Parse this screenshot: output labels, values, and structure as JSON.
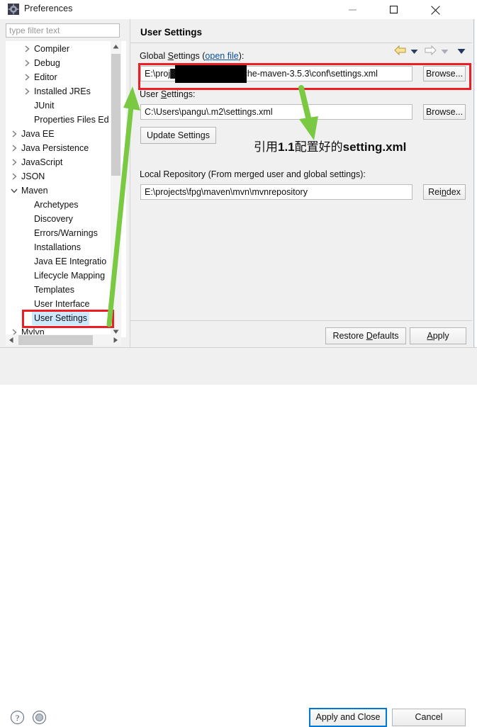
{
  "window": {
    "title": "Preferences",
    "icon": "preferences-gear-icon",
    "controls": {
      "minimize": "minimize-icon",
      "maximize": "maximize-icon",
      "close": "close-icon"
    }
  },
  "filter": {
    "placeholder": "type filter text",
    "value": ""
  },
  "tree": {
    "items": [
      {
        "label": "Compiler",
        "indent": 2,
        "twisty": "collapsed",
        "selected": false
      },
      {
        "label": "Debug",
        "indent": 2,
        "twisty": "collapsed",
        "selected": false
      },
      {
        "label": "Editor",
        "indent": 2,
        "twisty": "collapsed",
        "selected": false
      },
      {
        "label": "Installed JREs",
        "indent": 2,
        "twisty": "collapsed",
        "selected": false
      },
      {
        "label": "JUnit",
        "indent": 2,
        "twisty": "none",
        "selected": false
      },
      {
        "label": "Properties Files Ed",
        "indent": 2,
        "twisty": "none",
        "selected": false
      },
      {
        "label": "Java EE",
        "indent": 1,
        "twisty": "collapsed",
        "selected": false
      },
      {
        "label": "Java Persistence",
        "indent": 1,
        "twisty": "collapsed",
        "selected": false
      },
      {
        "label": "JavaScript",
        "indent": 1,
        "twisty": "collapsed",
        "selected": false
      },
      {
        "label": "JSON",
        "indent": 1,
        "twisty": "collapsed",
        "selected": false
      },
      {
        "label": "Maven",
        "indent": 1,
        "twisty": "expanded",
        "selected": false
      },
      {
        "label": "Archetypes",
        "indent": 2,
        "twisty": "none",
        "selected": false
      },
      {
        "label": "Discovery",
        "indent": 2,
        "twisty": "none",
        "selected": false
      },
      {
        "label": "Errors/Warnings",
        "indent": 2,
        "twisty": "none",
        "selected": false
      },
      {
        "label": "Installations",
        "indent": 2,
        "twisty": "none",
        "selected": false
      },
      {
        "label": "Java EE Integratio",
        "indent": 2,
        "twisty": "none",
        "selected": false
      },
      {
        "label": "Lifecycle Mapping",
        "indent": 2,
        "twisty": "none",
        "selected": false
      },
      {
        "label": "Templates",
        "indent": 2,
        "twisty": "none",
        "selected": false
      },
      {
        "label": "User Interface",
        "indent": 2,
        "twisty": "none",
        "selected": false
      },
      {
        "label": "User Settings",
        "indent": 2,
        "twisty": "none",
        "selected": true
      },
      {
        "label": "Mylyn",
        "indent": 1,
        "twisty": "collapsed",
        "selected": false
      }
    ]
  },
  "page": {
    "title": "User Settings",
    "toolbar": {
      "back": "back-arrow-icon",
      "back_menu": "back-dropdown-icon",
      "forward": "forward-arrow-icon",
      "forward_menu": "forward-dropdown-icon",
      "view_menu": "view-menu-dropdown-icon"
    },
    "global_settings": {
      "label_prefix": "Global Settings (",
      "link": "open file",
      "label_suffix": "):",
      "value": "E:\\proj██████████pache-maven-3.5.3\\conf\\settings.xml",
      "value_left": "E:\\proj",
      "value_right": "pache-maven-3.5.3\\conf\\settings.xml",
      "browse": "Browse..."
    },
    "user_settings": {
      "label": "User Settings:",
      "value": "C:\\Users\\pangu\\.m2\\settings.xml",
      "browse": "Browse..."
    },
    "update_settings": "Update Settings",
    "local_repository": {
      "label": "Local Repository (From merged user and global settings):",
      "value": "E:\\projects\\fpg\\maven\\mvn\\mvnrepository",
      "reindex": "Reindex"
    },
    "restore_defaults": "Restore Defaults",
    "apply": "Apply"
  },
  "footer": {
    "help_icon": "help-question-icon",
    "record_icon": "record-target-icon",
    "apply_and_close": "Apply and Close",
    "cancel": "Cancel"
  },
  "annotations": {
    "note_text": "引用1.1配置好的setting.xml",
    "note_parts": {
      "a": "引用",
      "b": "1.1",
      "c": "配置好的",
      "d": "setting.xml"
    },
    "highlight_color": "#ee1c25",
    "arrow_color": "#7ac943",
    "redaction_color": "#000000"
  }
}
